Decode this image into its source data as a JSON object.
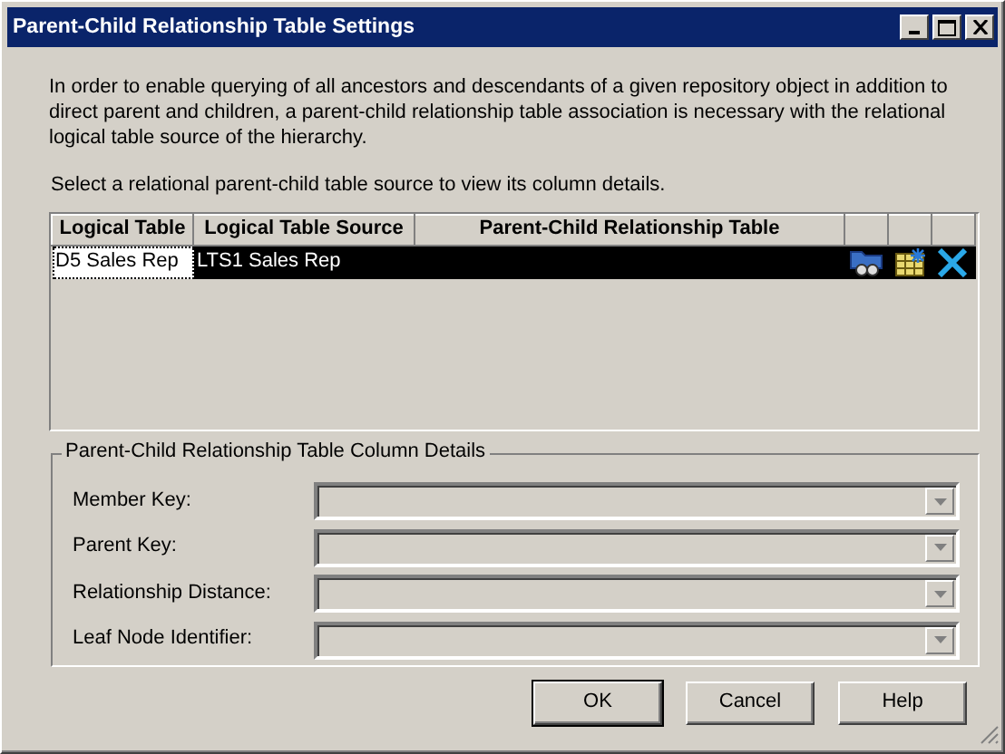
{
  "window": {
    "title": "Parent-Child Relationship Table Settings",
    "controls": [
      {
        "kind": "minimize"
      },
      {
        "kind": "maximize"
      },
      {
        "kind": "close"
      }
    ]
  },
  "description": "In order to enable querying of all ancestors and descendants of a given repository object in addition to direct parent and children, a parent-child relationship table association is necessary with the relational logical table source of the hierarchy.",
  "instruction": "Select a relational parent-child table source to view its column details.",
  "table": {
    "columns": [
      "Logical Table",
      "Logical Table Source",
      "Parent-Child Relationship Table"
    ],
    "rows": [
      {
        "logical_table": "D5 Sales Rep",
        "logical_table_source": "LTS1 Sales Rep",
        "selected": true
      }
    ]
  },
  "details": {
    "title": "Parent-Child Relationship Table Column Details",
    "fields": [
      {
        "label": "Member Key:",
        "disabled": true
      },
      {
        "label": "Parent Key:",
        "disabled": true
      },
      {
        "label": "Relationship Distance:",
        "disabled": true
      },
      {
        "label": "Leaf Node Identifier:",
        "disabled": true
      }
    ]
  },
  "buttons": [
    "OK",
    "Cancel",
    "Help"
  ]
}
